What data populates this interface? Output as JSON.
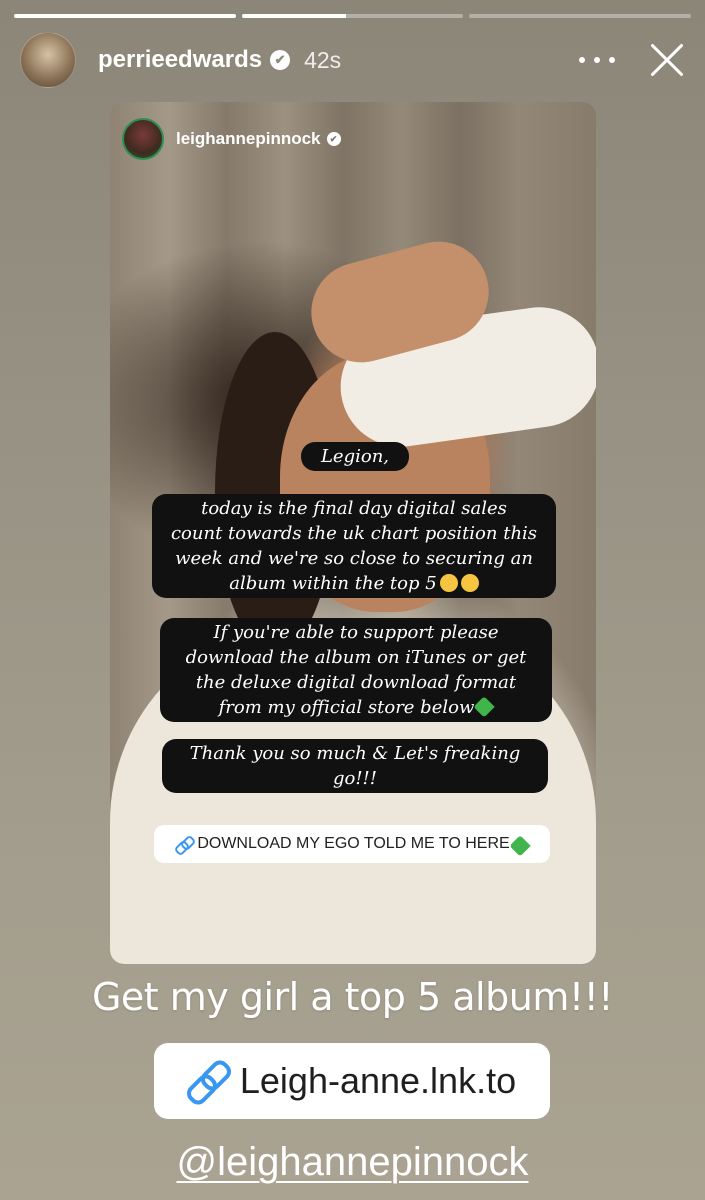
{
  "story": {
    "progress": [
      1.0,
      0.47,
      0.0
    ],
    "header": {
      "username": "perrieedwards",
      "verified_glyph": "✔",
      "time": "42s"
    }
  },
  "reshared_story": {
    "username": "leighannepinnock",
    "verified_glyph": "✔",
    "bubbles": [
      "Legion,",
      "today is the final day digital sales\ncount towards the uk chart position this\nweek and we're so close to securing an\nalbum within the top 5",
      "If you're able to support please\ndownload the album on iTunes or get\nthe deluxe digital download format\nfrom my official store below",
      "Thank you so much & Let's freaking\ngo!!!"
    ],
    "link_sticker": "DOWNLOAD MY EGO TOLD ME TO HERE"
  },
  "caption": "Get my girl a top 5 album!!!",
  "link": "Leigh-anne.lnk.to",
  "mention": "@leighannepinnock",
  "icons": {
    "more": "more-options-icon",
    "close": "close-icon",
    "link": "link-icon",
    "verified": "verified-badge-icon"
  },
  "colors": {
    "link_blue": "#3897f0",
    "bubble_bg": "#111111",
    "heart_green": "#3fb54c"
  }
}
